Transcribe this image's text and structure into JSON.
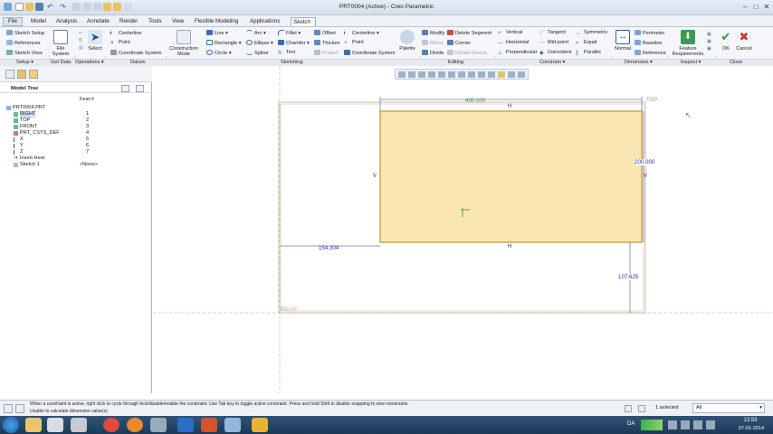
{
  "window": {
    "title": "PRT0004 (Active) - Creo Parametric",
    "min": "–",
    "max": "□",
    "close": "✕"
  },
  "menu": {
    "file": "File",
    "tabs": [
      "Model",
      "Analysis",
      "Annotate",
      "Render",
      "Tools",
      "View",
      "Flexible Modeling",
      "Applications",
      "Sketch"
    ]
  },
  "ribbon": {
    "setup": {
      "sketch_setup": "Sketch Setup",
      "references": "References",
      "sketch_view": "Sketch View"
    },
    "get_data": {
      "file_system": "File System"
    },
    "operations": {
      "select": "Select"
    },
    "datum": {
      "centerline": "Centerline",
      "point": "Point",
      "coordinate_system": "Coordinate System"
    },
    "sketching": {
      "construction_mode": "Construction Mode",
      "line": "Line",
      "rectangle": "Rectangle",
      "circle": "Circle",
      "arc": "Arc",
      "ellipse": "Ellipse",
      "spline": "Spline",
      "fillet": "Fillet",
      "chamfer": "Chamfer",
      "text": "Text",
      "offset": "Offset",
      "thicken": "Thicken",
      "project": "Project",
      "centerline": "Centerline",
      "point": "Point",
      "coordinate_system": "Coordinate System",
      "palette": "Palette"
    },
    "editing": {
      "modify": "Modify",
      "mirror": "Mirror",
      "divide": "Divide",
      "delete_segment": "Delete Segment",
      "corner": "Corner",
      "rotate_resize": "Rotate Resize"
    },
    "constrain": {
      "vertical": "Vertical",
      "horizontal": "Horizontal",
      "perpendicular": "Perpendicular",
      "tangent": "Tangent",
      "mid_point": "Mid-point",
      "coincident": "Coincident",
      "symmetric": "Symmetric",
      "equal": "Equal",
      "parallel": "Parallel"
    },
    "dimension": {
      "normal": "Normal",
      "perimeter": "Perimeter",
      "baseline": "Baseline",
      "reference": "Reference"
    },
    "inspect": {
      "feature_requirements": "Feature Requirements"
    },
    "close": {
      "ok": "OK",
      "cancel": "Cancel"
    },
    "group_labels": {
      "setup": "Setup ▾",
      "get_data": "Get Data",
      "operations": "Operations ▾",
      "datum": "Datum",
      "sketching": "Sketching",
      "editing": "Editing",
      "constrain": "Constrain ▾",
      "dimension": "Dimension ▾",
      "inspect": "Inspect ▾",
      "close": "Close"
    }
  },
  "model_tree": {
    "title": "Model Tree",
    "col_feat": "Feat #",
    "items": [
      {
        "name": "PRT0004.PRT",
        "feat": ""
      },
      {
        "name": "RIGHT",
        "feat": "1"
      },
      {
        "name": "TOP",
        "feat": "2"
      },
      {
        "name": "FRONT",
        "feat": "3"
      },
      {
        "name": "PRT_CSYS_DEF",
        "feat": "4"
      },
      {
        "name": "X",
        "feat": "5"
      },
      {
        "name": "Y",
        "feat": "6"
      },
      {
        "name": "Z",
        "feat": "7"
      },
      {
        "name": "Insert Here",
        "feat": ""
      },
      {
        "name": "Sketch 1",
        "feat": "<None>"
      }
    ]
  },
  "sketch": {
    "dim_width": "400.000",
    "dim_height": "200.000",
    "dim_left": "154.304",
    "dim_bottom": "107.625",
    "label_top": "TOP",
    "label_right": "RIGHT",
    "constraint_h": "H",
    "constraint_v": "V"
  },
  "status": {
    "line1": "When a constraint is active, right click to cycle through lock/disable/enable the constraint. Use Tab key to toggle active constraint. Press and hold Shift to disable snapping to new constraints.",
    "line2": "Unable to calculate dimension value(s)",
    "selected": "1 selected",
    "filter": "All"
  },
  "taskbar": {
    "lang": "DA",
    "time": "12:53",
    "date": "07-01-2014"
  },
  "colors": {
    "accent": "#2a6fbf",
    "sketch_fill": "#f8e6b3",
    "sketch_line": "#c9a23c",
    "dim": "#2233aa",
    "ref": "#7fd0a0"
  }
}
